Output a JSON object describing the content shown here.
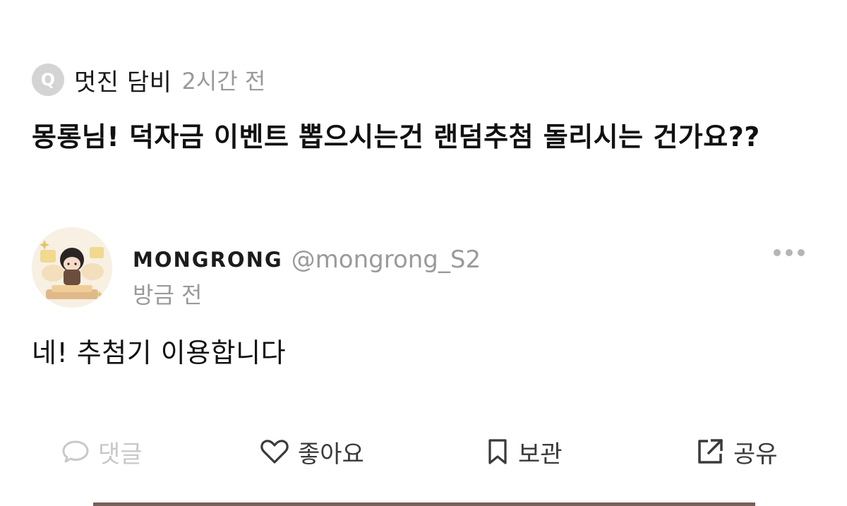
{
  "question": {
    "avatar_letter": "Q",
    "author": "멋진 담비",
    "time": "2시간 전",
    "text": "몽롱님! 덕자금 이벤트 뽑으시는건 랜덤추첨 돌리시는 건가요??"
  },
  "answer": {
    "name": "MONGRONG",
    "handle": "@mongrong_S2",
    "time": "방금 전",
    "text": "네! 추첨기 이용합니다"
  },
  "actions": {
    "comment": "댓글",
    "like": "좋아요",
    "save": "보관",
    "share": "공유"
  },
  "icons": {
    "avatar": "q-avatar-icon",
    "more": "more-horizontal-icon",
    "comment": "comment-bubble-icon",
    "like": "heart-icon",
    "save": "bookmark-icon",
    "share": "share-arrow-icon"
  },
  "colors": {
    "primary_text": "#111111",
    "secondary_text": "#9a9a9a",
    "disabled_text": "#c8c8c8",
    "q_avatar_bg": "#d4d4d4",
    "bottom_bar": "#7a5f5a"
  }
}
